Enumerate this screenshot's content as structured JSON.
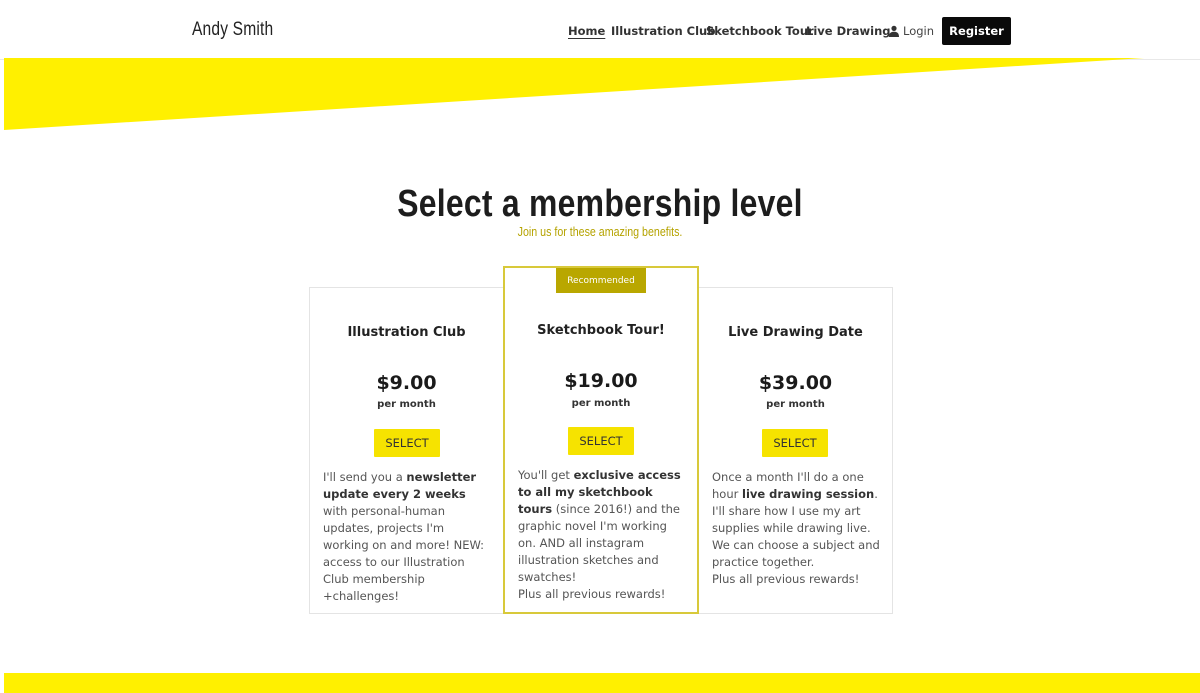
{
  "header": {
    "brand": "Andy Smith",
    "nav": [
      {
        "label": "Home",
        "active": true
      },
      {
        "label": "Illustration Club",
        "active": false
      },
      {
        "label": "Sketchbook Tour",
        "active": false
      },
      {
        "label": "Live Drawing",
        "active": false
      }
    ],
    "login_label": "Login",
    "register_label": "Register"
  },
  "colors": {
    "accent_yellow": "#fff000",
    "olive": "#b9a700",
    "dark": "#0a0a0a"
  },
  "hero": {
    "title": "Select a membership level",
    "subtitle": "Join us for these amazing benefits."
  },
  "plans": [
    {
      "name": "Illustration Club",
      "price": "$9.00",
      "period": "per month",
      "button": "SELECT",
      "description": [
        {
          "text": "I'll send you a ",
          "bold": false
        },
        {
          "text": "newsletter update every 2 weeks",
          "bold": true
        },
        {
          "text": " with personal-human updates, projects I'm working on and more! NEW: access to our Illustration Club membership +challenges!",
          "bold": false
        }
      ]
    },
    {
      "name": "Sketchbook Tour!",
      "badge": "Recommended",
      "price": "$19.00",
      "period": "per month",
      "button": "SELECT",
      "description": [
        {
          "text": "You'll get ",
          "bold": false
        },
        {
          "text": "exclusive access to all my sketchbook tours",
          "bold": true
        },
        {
          "text": " (since 2016!) and the graphic novel I'm working on. AND all instagram illustration sketches and swatches!",
          "bold": false
        }
      ],
      "footer_line": "Plus all previous rewards!"
    },
    {
      "name": "Live Drawing Date",
      "price": "$39.00",
      "period": "per month",
      "button": "SELECT",
      "description": [
        {
          "text": "Once a month I'll do a one hour ",
          "bold": false
        },
        {
          "text": "live drawing session",
          "bold": true
        },
        {
          "text": ". I'll share how I use my art supplies while drawing live. We can choose a subject and practice together.",
          "bold": false
        }
      ],
      "footer_line": "Plus all previous rewards!"
    }
  ]
}
